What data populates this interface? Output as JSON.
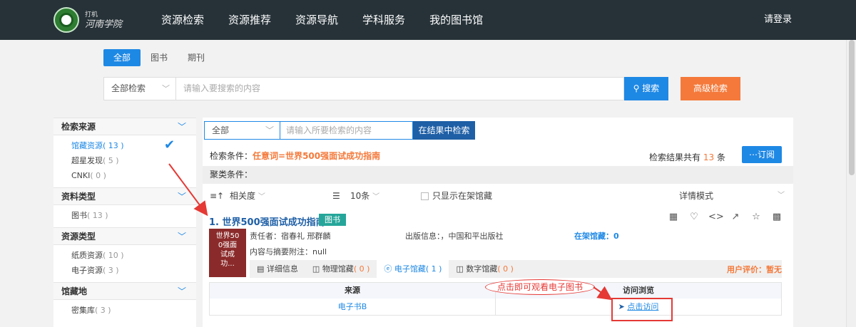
{
  "header": {
    "logo_small": "打机",
    "logo_large": "河南学院",
    "nav": [
      "资源检索",
      "资源推荐",
      "资源导航",
      "学科服务",
      "我的图书馆"
    ],
    "login": "请登录"
  },
  "search": {
    "tabs": [
      "全部",
      "图书",
      "期刊"
    ],
    "scope": "全部检索",
    "placeholder": "请输入要搜索的内容",
    "search_btn": "搜索",
    "advanced_btn": "高级检索"
  },
  "facets": [
    {
      "title": "检索来源",
      "items": [
        {
          "label": "馆藏资源",
          "count": "( 13 )",
          "selected": true
        },
        {
          "label": "超星发现",
          "count": "( 5 )"
        },
        {
          "label": "CNKI",
          "count": "( 0 )"
        }
      ]
    },
    {
      "title": "资料类型",
      "items": [
        {
          "label": "图书",
          "count": "( 13 )"
        }
      ]
    },
    {
      "title": "资源类型",
      "items": [
        {
          "label": "纸质资源",
          "count": "( 10 )"
        },
        {
          "label": "电子资源",
          "count": "( 3 )"
        }
      ]
    },
    {
      "title": "馆藏地",
      "items": [
        {
          "label": "密集库",
          "count": "( 3 )"
        }
      ]
    }
  ],
  "results": {
    "scope": "全部",
    "placeholder": "请输入所要检索的内容",
    "refine_btn": "在结果中检索",
    "cond_label": "检索条件：",
    "cond_value": "任意词=世界500强面试成功指南",
    "count_prefix": "检索结果共有",
    "count": "13",
    "count_suffix": "条",
    "subscribe": "订阅",
    "cluster": "聚类条件：",
    "sort": "相关度",
    "page_size": "10条",
    "only_shelf": "只显示在架馆藏",
    "view_mode": "详情模式"
  },
  "item": {
    "title": "1. 世界500强面试成功指南",
    "badge": "图书",
    "cover_text": "世界500强面试成功...",
    "cover_lines": [
      "世界50",
      "0强面",
      "试成",
      "功..."
    ],
    "author": "责任者：宿春礼 邢群麟",
    "publisher": "出版信息：，中国和平出版社",
    "shelf": "在架馆藏：0",
    "abstract": "内容与摘要附注：null",
    "tabs": [
      {
        "label": "详细信息",
        "count": ""
      },
      {
        "label": "物理馆藏",
        "count": "( 0 )"
      },
      {
        "label": "电子馆藏",
        "count": "( 1 )"
      },
      {
        "label": "数字馆藏",
        "count": "( 0 )"
      }
    ],
    "rating": "用户评价：暂无",
    "table_headers": [
      "来源",
      "访问浏览"
    ],
    "table_row": {
      "source": "电子书B",
      "visit": "点击访问"
    }
  },
  "annotation": {
    "text": "点击即可观看电子图书",
    "color": "#e53935"
  },
  "colors": {
    "accent": "#1e88e5",
    "orange": "#f4793a",
    "header_bg": "#263238",
    "teal": "#26a69a"
  }
}
